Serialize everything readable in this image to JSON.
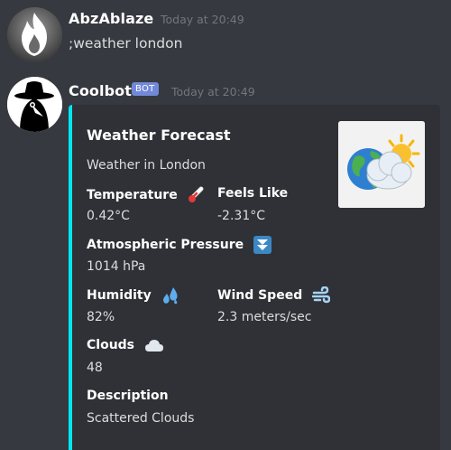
{
  "messages": [
    {
      "author": "AbzAblaze",
      "timestamp": "Today at 20:49",
      "text": ";weather london"
    },
    {
      "author": "Coolbot",
      "bot_tag": "BOT",
      "timestamp": "Today at 20:49",
      "embed": {
        "accent_color": "#00e5f2",
        "title": "Weather Forecast",
        "description": "Weather in London",
        "thumbnail": "weather-globe-sun-cloud-icon",
        "fields": {
          "temperature": {
            "name": "Temperature",
            "value": "0.42°C",
            "emoji": "thermometer-icon"
          },
          "feels_like": {
            "name": "Feels Like",
            "value": "-2.31°C"
          },
          "pressure": {
            "name": "Atmospheric Pressure",
            "value": "1014 hPa",
            "emoji": "double-down-arrow-icon"
          },
          "humidity": {
            "name": "Humidity",
            "value": "82%",
            "emoji": "droplets-icon"
          },
          "wind_speed": {
            "name": "Wind Speed",
            "value": "2.3 meters/sec",
            "emoji": "wind-icon"
          },
          "clouds": {
            "name": "Clouds",
            "value": "48",
            "emoji": "cloud-icon"
          },
          "description": {
            "name": "Description",
            "value": "Scattered Clouds"
          }
        }
      }
    }
  ]
}
